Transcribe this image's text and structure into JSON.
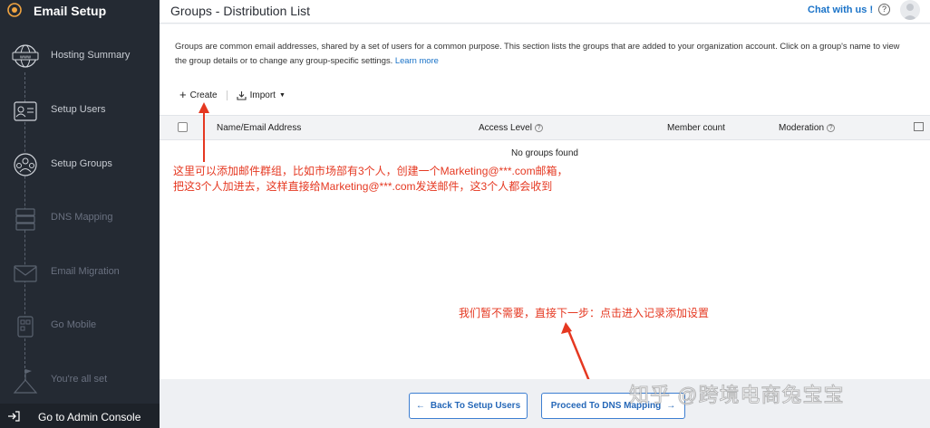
{
  "app": {
    "title": "Email Setup",
    "brand_color": "#242a33",
    "accent": "#1a73c8"
  },
  "sidebar": {
    "steps": [
      {
        "label": "Hosting Summary",
        "icon": "globe-www-icon",
        "state": "done"
      },
      {
        "label": "Setup Users",
        "icon": "user-card-icon",
        "state": "done"
      },
      {
        "label": "Setup Groups",
        "icon": "group-icon",
        "state": "active"
      },
      {
        "label": "DNS Mapping",
        "icon": "server-icon",
        "state": "pending"
      },
      {
        "label": "Email Migration",
        "icon": "envelope-icon",
        "state": "pending"
      },
      {
        "label": "Go Mobile",
        "icon": "qr-code-icon",
        "state": "pending"
      },
      {
        "label": "You're all set",
        "icon": "flag-icon",
        "state": "pending"
      }
    ],
    "admin_label": "Go to Admin Console"
  },
  "header": {
    "title": "Groups - Distribution List",
    "chat_label": "Chat with us !",
    "help_glyph": "?"
  },
  "main": {
    "description": "Groups are common email addresses, shared by a set of users for a common purpose. This section lists the groups that are added to your organization account. Click on a group's name to view the group details or to change any group-specific settings.",
    "learn_more": "Learn more",
    "toolbar": {
      "create_label": "Create",
      "import_label": "Import"
    },
    "table": {
      "columns": [
        "Name/Email Address",
        "Access Level",
        "Member count",
        "Moderation"
      ],
      "empty_text": "No groups found"
    }
  },
  "annotations": {
    "note1_line1": "这里可以添加邮件群组，比如市场部有3个人，创建一个Marketing@***.com邮箱，",
    "note1_line2": "把这3个人加进去，这样直接给Marketing@***.com发送邮件，这3个人都会收到",
    "note2": "我们暂不需要，直接下一步：点击进入记录添加设置",
    "color": "#e53821"
  },
  "footer": {
    "back_label": "Back To Setup Users",
    "next_label": "Proceed To DNS Mapping"
  },
  "watermark": "知乎 @跨境电商兔宝宝"
}
